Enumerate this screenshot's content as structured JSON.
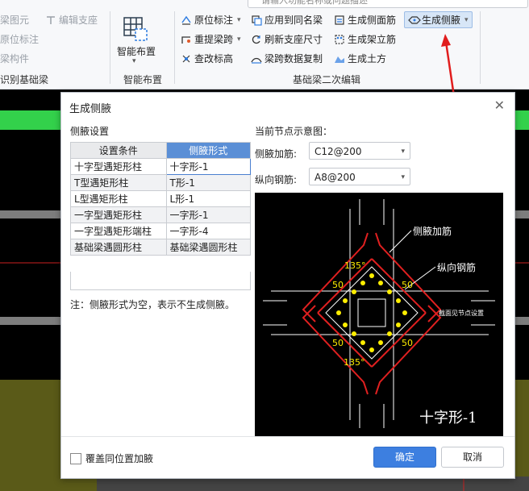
{
  "search": {
    "placeholder": "请输入功能名称或问题描述"
  },
  "ribbon": {
    "left_items": [
      "梁图元",
      "原位标注",
      "梁构件"
    ],
    "left_group": "识别基础梁",
    "edit_support": "编辑支座",
    "smart_layout": "智能布置",
    "smart_group": "智能布置",
    "col1": [
      "原位标注",
      "重提梁跨",
      "查改标高"
    ],
    "col2": [
      "应用到同名梁",
      "刷新支座尺寸",
      "梁跨数据复制"
    ],
    "col3": [
      "生成侧面筋",
      "生成架立筋",
      "生成土方"
    ],
    "col4": [
      "生成侧腋"
    ],
    "group2": "基础梁二次编辑"
  },
  "dialog": {
    "title": "生成侧腋",
    "left_section": "侧腋设置",
    "table": {
      "headers": [
        "设置条件",
        "侧腋形式"
      ],
      "rows": [
        [
          "十字型遇矩形柱",
          "十字形-1"
        ],
        [
          "T型遇矩形柱",
          "T形-1"
        ],
        [
          "L型遇矩形柱",
          "L形-1"
        ],
        [
          "一字型遇矩形柱",
          "一字形-1"
        ],
        [
          "一字型遇矩形端柱",
          "一字形-4"
        ],
        [
          "基础梁遇圆形柱",
          "基础梁遇圆形柱"
        ]
      ]
    },
    "note": "注：侧腋形式为空，表示不生成侧腋。",
    "right_section": "当前节点示意图：",
    "field1_label": "侧腋加筋:",
    "field1_value": "C12@200",
    "field2_label": "纵向钢筋:",
    "field2_value": "A8@200",
    "diagram": {
      "label_rebar": "侧腋加筋",
      "label_long": "纵向钢筋",
      "angle_top": "135°",
      "angle_bottom": "135°",
      "dim_left_top": "50",
      "dim_right_top": "50",
      "dim_left_bottom": "50",
      "dim_right_bottom": "50",
      "section_note": "截面见节点设置",
      "shape_name": "十字形-1"
    },
    "overlay_checkbox": "覆盖同位置加腋",
    "ok": "确定",
    "cancel": "取消"
  }
}
